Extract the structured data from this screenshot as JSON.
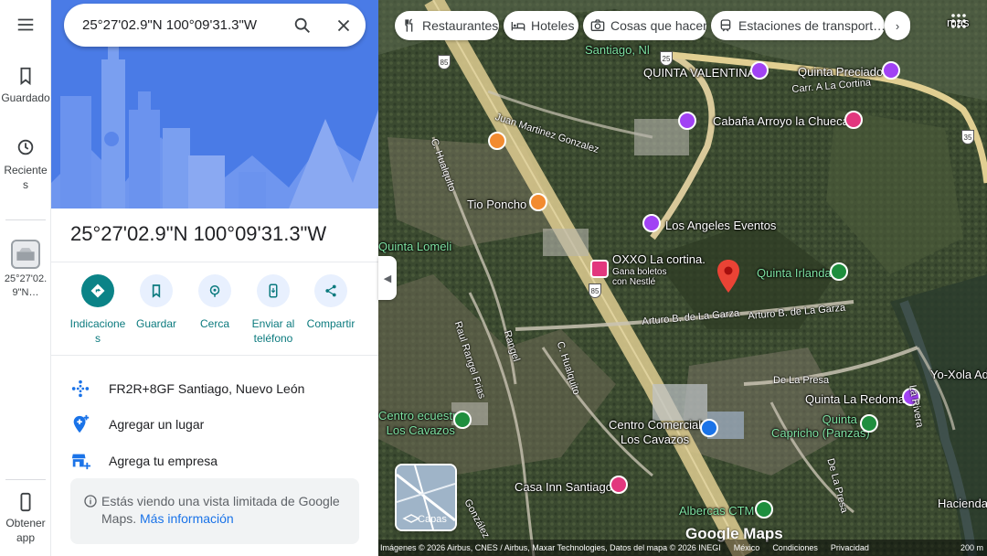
{
  "rail": {
    "saved_label": "Guardado",
    "recent_label": "Reciente\ns",
    "recent_place_label": "25°27'02.\n9\"N…",
    "get_app_label": "Obtener\napp"
  },
  "search": {
    "value": "25°27'02.9\"N 100°09'31.3\"W"
  },
  "place": {
    "title": "25°27'02.9\"N 100°09'31.3\"W"
  },
  "actions": [
    {
      "label": "Indicacione\ns",
      "icon": "directions-icon"
    },
    {
      "label": "Guardar",
      "icon": "bookmark-icon"
    },
    {
      "label": "Cerca",
      "icon": "nearby-icon"
    },
    {
      "label": "Enviar al\nteléfono",
      "icon": "send-to-phone-icon"
    },
    {
      "label": "Compartir",
      "icon": "share-icon"
    }
  ],
  "info_rows": [
    {
      "text": "FR2R+8GF Santiago, Nuevo León",
      "icon": "plus-code-icon"
    },
    {
      "text": "Agregar un lugar",
      "icon": "add-place-icon"
    },
    {
      "text": "Agrega tu empresa",
      "icon": "add-business-icon"
    }
  ],
  "notice": {
    "text": "Estás viendo una vista limitada de Google Maps.",
    "link": "Más información"
  },
  "chips": [
    {
      "label": "Restaurantes",
      "icon": "restaurant-icon"
    },
    {
      "label": "Hoteles",
      "icon": "hotel-icon"
    },
    {
      "label": "Cosas que hacer",
      "icon": "camera-icon"
    },
    {
      "label": "Estaciones de transport…",
      "icon": "transit-icon"
    }
  ],
  "map_labels": {
    "quinta_valentina": "QUINTA VALENTINA",
    "quinta_preciado": "Quinta Preciado",
    "carr_la_cortina": "Carr. A La Cortina",
    "cabana_arroyo": "Cabaña Arroyo la Chueca",
    "santiago_nl": "Santiago, Nl",
    "juan_martinez": "Juan Martinez Gonzalez",
    "c_hualquito": "C. Hualquito",
    "tio_poncho": "Tio Poncho",
    "los_angeles": "Los Angeles Eventos",
    "quinta_lomeli": "Quinta Lomeli",
    "oxxo": "OXXO La cortina.",
    "oxxo_sub": "Gana boletos\ncon Nestlé",
    "quinta_irlanda": "Quinta Irlanda",
    "arturo1": "Arturo B. de La Garza",
    "arturo2": "Arturo B. de La Garza",
    "raul_rangel": "Raul Rangel Frias",
    "rangel": "Rangel",
    "c_hualquito2": "C. Hualquito",
    "de_la_presa": "De La Presa",
    "de_la_presa2": "De La Presa",
    "yo_xola": "Yo-Xola Adv",
    "quinta_redoma": "Quinta La Redoma",
    "quinta_capricho": "Quinta el\nCapricho (Panzas)",
    "centro_ecuestre": "Centro ecuestre\nLos Cavazos",
    "centro_comercial": "Centro Comercial\nLos Cavazos",
    "la_rivera": "La Rivera",
    "casa_inn": "Casa Inn Santiago",
    "albercas": "Albercas CTM",
    "hacienda": "Hacienda Bou",
    "gonzalez": "González",
    "mas": "mas",
    "hwy85a": "85",
    "hwy85b": "85",
    "hwy35": "35",
    "hwy25": "25"
  },
  "layers": {
    "label": "Capas"
  },
  "attribution": {
    "imagery": "Imágenes © 2026 Airbus, CNES / Airbus, Maxar Technologies, Datos del mapa © 2026 INEGI",
    "mexico": "México",
    "conditions": "Condiciones",
    "privacy": "Privacidad",
    "scale": "200 m"
  },
  "google_logo": "Google Maps",
  "colors": {
    "accent": "#0b8387",
    "hero": "#4d7ce8",
    "link": "#1a73e8",
    "marker": "#ea4335"
  }
}
